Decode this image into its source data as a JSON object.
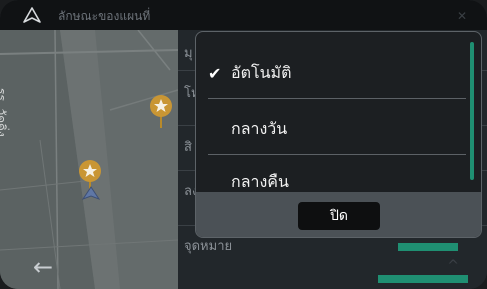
{
  "header": {
    "title": "ลักษณะของแผนที่",
    "nav_icon": "navigation-arrow-icon",
    "close_icon": "close-icon"
  },
  "map": {
    "street_label": "รร. วัดดิ่ง",
    "pois": [
      "star-poi-icon",
      "star-poi-icon"
    ],
    "vehicle_icon": "vehicle-position-icon"
  },
  "background_list": {
    "fragments": [
      "มุ",
      "โห",
      "สิ",
      "ลง",
      "จุดหมาย"
    ]
  },
  "dialog": {
    "options": [
      {
        "label": "อัตโนมัติ",
        "selected": true
      },
      {
        "label": "กลางวัน",
        "selected": false
      },
      {
        "label": "กลางคืน",
        "selected": false
      }
    ],
    "check_glyph": "✔",
    "close_label": "ปิด"
  },
  "footer": {
    "back_glyph": "←",
    "up_glyph": "^"
  },
  "colors": {
    "accent": "#1f8f72",
    "dialog_bg": "#1c1f22",
    "map_bg": "#596060"
  }
}
